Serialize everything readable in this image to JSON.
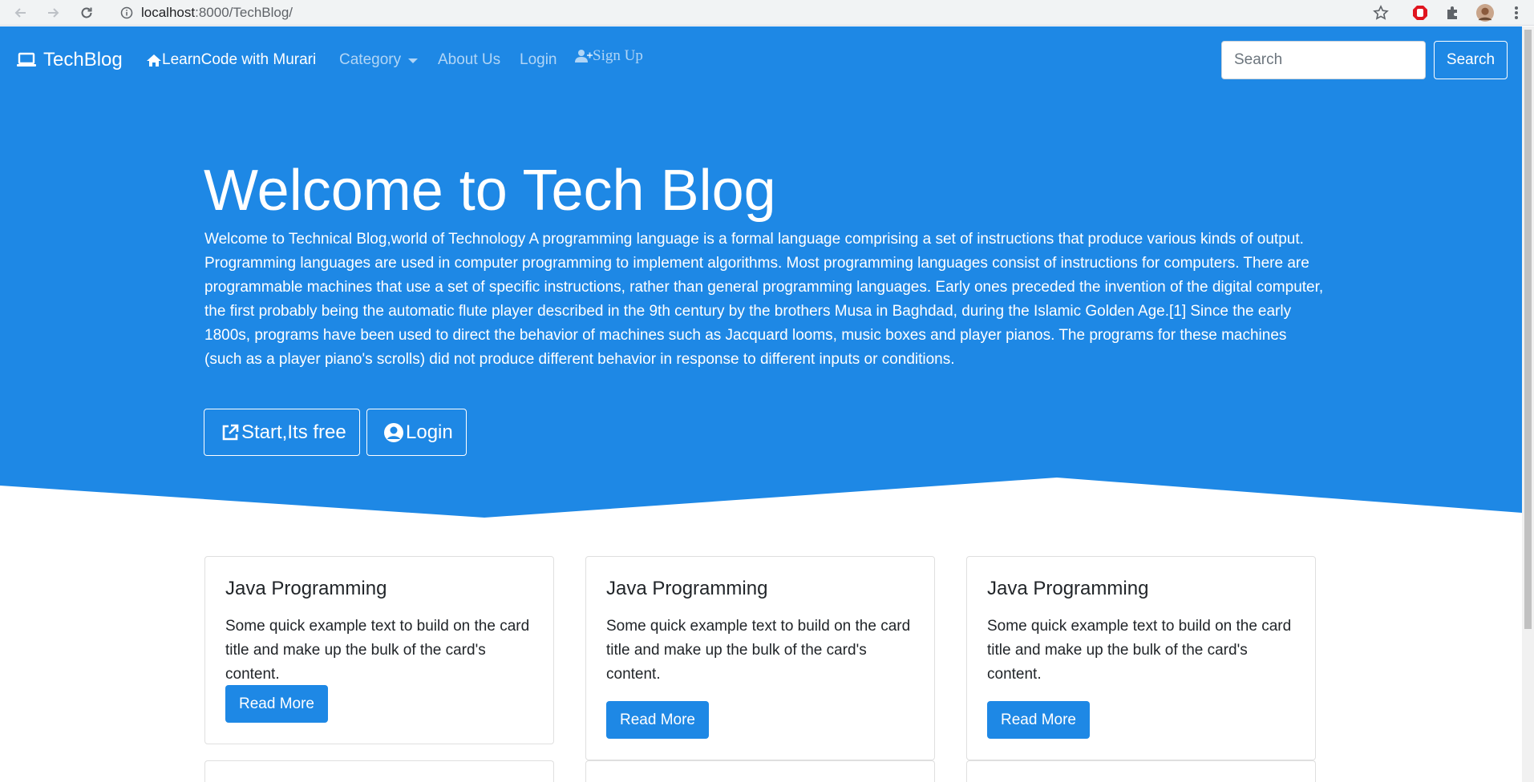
{
  "browser": {
    "url_host": "localhost",
    "url_path": ":8000/TechBlog/",
    "icons": [
      "back-arrow-icon",
      "forward-arrow-icon",
      "reload-icon",
      "info-icon",
      "star-icon",
      "adblock-icon",
      "extensions-icon",
      "profile-avatar",
      "menu-icon"
    ]
  },
  "navbar": {
    "brand": "TechBlog",
    "links": {
      "home": "LearnCode with Murari",
      "category": "Category",
      "about": "About Us",
      "login": "Login",
      "signup": "Sign Up"
    },
    "search_placeholder": "Search",
    "search_button": "Search"
  },
  "hero": {
    "title": "Welcome to Tech Blog",
    "text": "Welcome to Technical Blog,world of Technology A programming language is a formal language comprising a set of instructions that produce various kinds of output. Programming languages are used in computer programming to implement algorithms. Most programming languages consist of instructions for computers. There are programmable machines that use a set of specific instructions, rather than general programming languages. Early ones preceded the invention of the digital computer, the first probably being the automatic flute player described in the 9th century by the brothers Musa in Baghdad, during the Islamic Golden Age.[1] Since the early 1800s, programs have been used to direct the behavior of machines such as Jacquard looms, music boxes and player pianos. The programs for these machines (such as a player piano's scrolls) did not produce different behavior in response to different inputs or conditions.",
    "start_button": "Start,Its free",
    "login_button": "Login"
  },
  "cards": [
    {
      "title": "Java Programming",
      "text": "Some quick example text to build on the card title and make up the bulk of the card's content.",
      "button": "Read More"
    },
    {
      "title": "Java Programming",
      "text": "Some quick example text to build on the card title and make up the bulk of the card's content.",
      "button": "Read More"
    },
    {
      "title": "Java Programming",
      "text": "Some quick example text to build on the card title and make up the bulk of the card's content.",
      "button": "Read More"
    }
  ],
  "colors": {
    "primary": "#1e88e5",
    "white": "#ffffff",
    "text_dark": "#212529"
  }
}
